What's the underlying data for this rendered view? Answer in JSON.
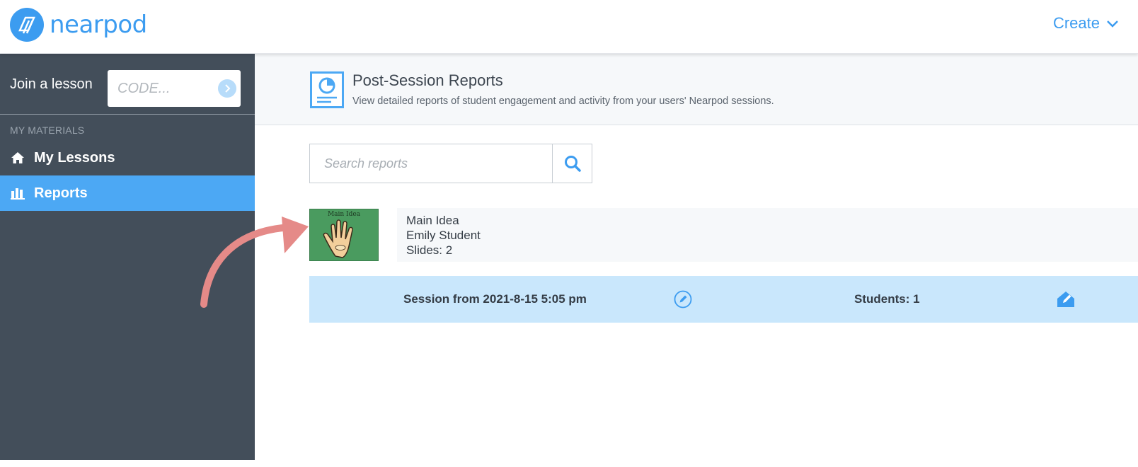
{
  "app": {
    "brand": "nearpod"
  },
  "header": {
    "create_label": "Create"
  },
  "sidebar": {
    "join_label": "Join a lesson",
    "code_placeholder": "CODE...",
    "section_title": "MY MATERIALS",
    "items": [
      {
        "label": "My Lessons",
        "icon": "home-icon"
      },
      {
        "label": "Reports",
        "icon": "bar-chart-icon",
        "active": true
      }
    ]
  },
  "page": {
    "title": "Post-Session Reports",
    "subtitle": "View detailed reports of student engagement and activity from your users' Nearpod sessions."
  },
  "search": {
    "placeholder": "Search reports"
  },
  "lesson": {
    "thumb_caption": "Main Idea",
    "title": "Main Idea",
    "owner": "Emily Student",
    "slides": "Slides: 2"
  },
  "session": {
    "date_label": "Session from 2021-8-15 5:05 pm",
    "students_label": "Students: 1"
  },
  "colors": {
    "brand": "#3c9cf0",
    "sidebar": "#434e5a",
    "active_nav": "#4ca8f4",
    "session_row": "#c9e7fc",
    "annotation_arrow": "#e58a88"
  }
}
